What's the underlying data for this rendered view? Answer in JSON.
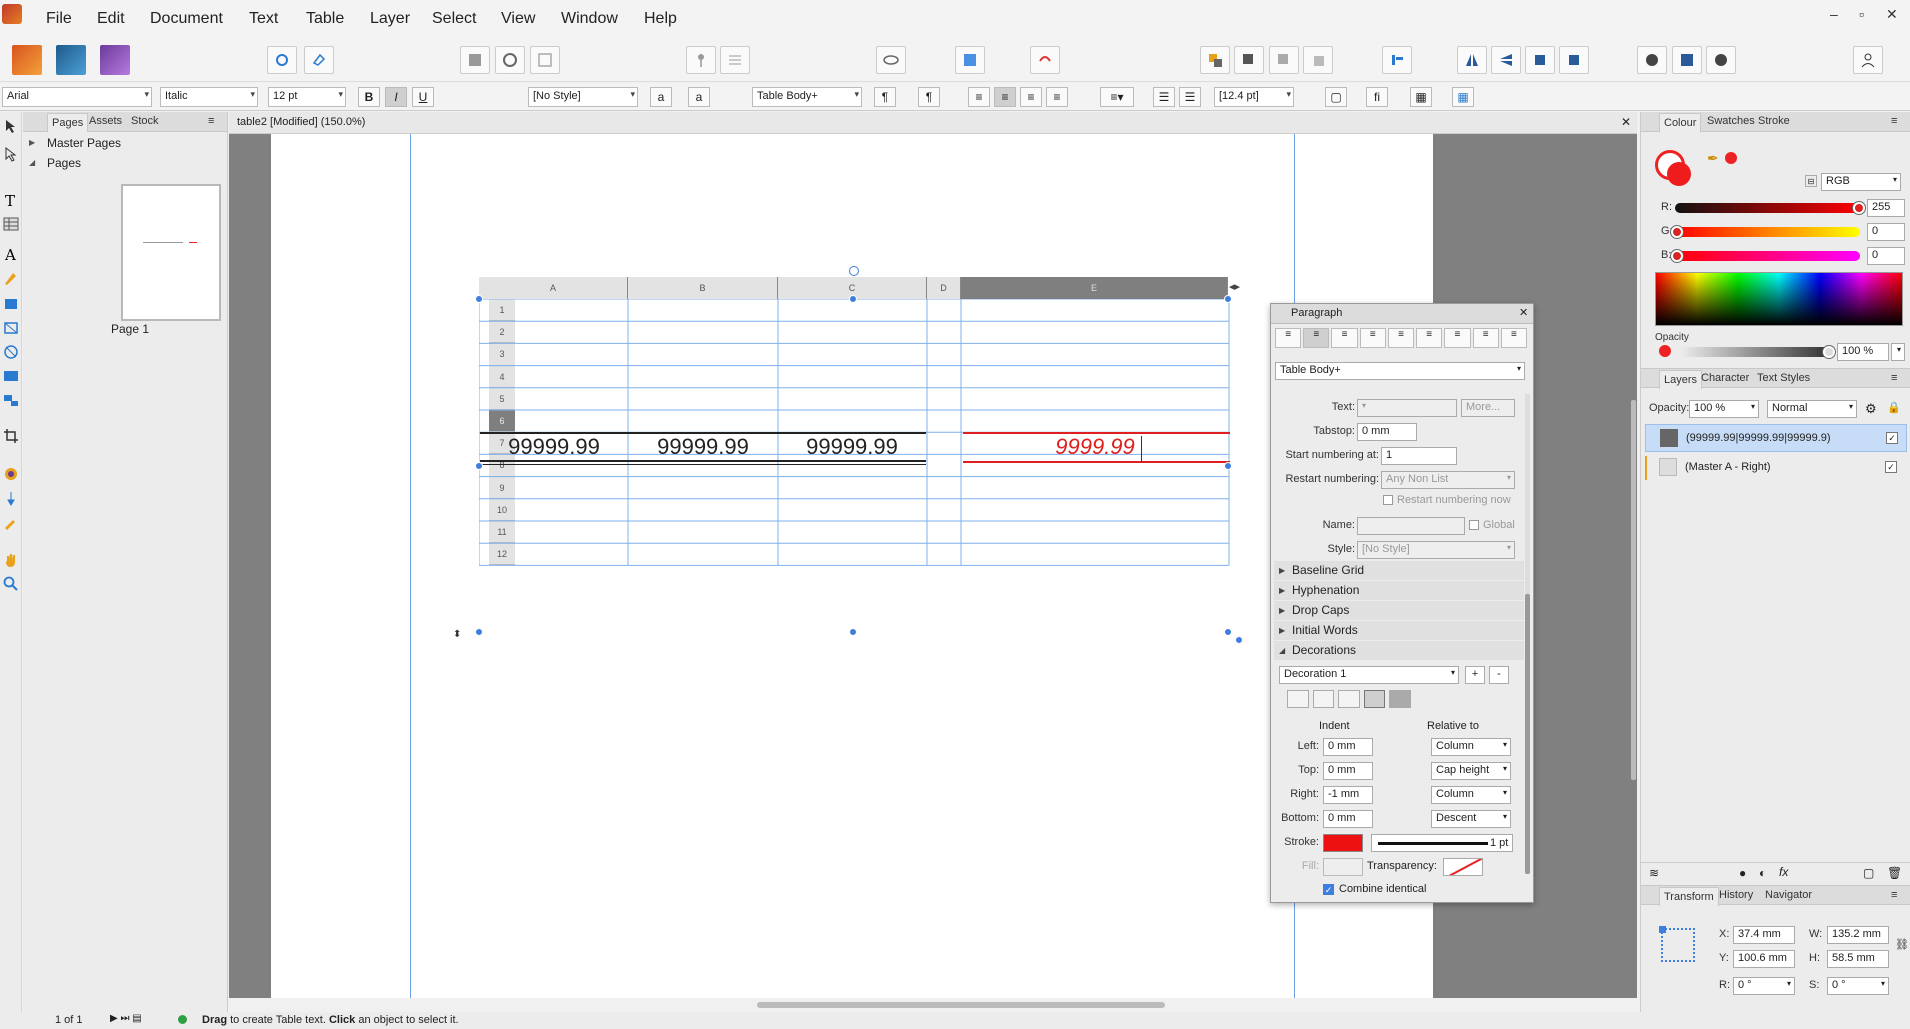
{
  "menu": {
    "items": [
      "File",
      "Edit",
      "Document",
      "Text",
      "Table",
      "Layer",
      "Select",
      "View",
      "Window",
      "Help"
    ]
  },
  "window_controls": [
    "–",
    "▫",
    "✕"
  ],
  "context_toolbar": {
    "font": "Arial",
    "style": "Italic",
    "size": "12 pt",
    "bold": "B",
    "italic": "I",
    "underline": "U",
    "text_color": "#ee1c1c",
    "char_style": "[No Style]",
    "para_style": "Table Body+",
    "leading": "[12.4 pt]"
  },
  "pages_panel": {
    "tabs": [
      "Pages",
      "Assets",
      "Stock"
    ],
    "master_pages": "Master Pages",
    "pages": "Pages",
    "page_label": "Page 1"
  },
  "document": {
    "tab_title": "table2 [Modified] (150.0%)",
    "close": "✕"
  },
  "table": {
    "columns": [
      "A",
      "B",
      "C",
      "D",
      "E"
    ],
    "rows": [
      "1",
      "2",
      "3",
      "4",
      "5",
      "6",
      "7",
      "8",
      "9",
      "10",
      "11",
      "12"
    ],
    "cells_row6": [
      "99999.99",
      "99999.99",
      "99999.99",
      "",
      "9999.99"
    ],
    "selected_row": "6",
    "accent": "#3d7ede",
    "decoration_color": "#e02020"
  },
  "paragraph_panel": {
    "title": "Paragraph",
    "style": "Table Body+",
    "text_label": "Text:",
    "more_button": "More...",
    "tabstop_label": "Tabstop:",
    "tabstop_value": "0 mm",
    "start_numbering_label": "Start numbering at:",
    "start_numbering_value": "1",
    "restart_label": "Restart numbering:",
    "restart_value": "Any Non List",
    "restart_now": "Restart numbering now",
    "name_label": "Name:",
    "global_label": "Global",
    "style_label": "Style:",
    "style_value": "[No Style]",
    "sections": [
      "Baseline Grid",
      "Hyphenation",
      "Drop Caps",
      "Initial Words",
      "Decorations"
    ],
    "decoration_select": "Decoration 1",
    "add": "+",
    "remove": "-",
    "indent_header": "Indent",
    "relative_header": "Relative to",
    "left_label": "Left:",
    "left_value": "0 mm",
    "left_rel": "Column",
    "top_label": "Top:",
    "top_value": "0 mm",
    "top_rel": "Cap height",
    "right_label": "Right:",
    "right_value": "-1 mm",
    "right_rel": "Column",
    "bottom_label": "Bottom:",
    "bottom_value": "0 mm",
    "bottom_rel": "Descent",
    "stroke_label": "Stroke:",
    "stroke_color": "#ee1111",
    "stroke_width": "1 pt",
    "fill_label": "Fill:",
    "transparency_label": "Transparency:",
    "combine_label": "Combine identical"
  },
  "colour_panel": {
    "tabs": [
      "Colour",
      "Swatches",
      "Stroke"
    ],
    "model": "RGB",
    "r_label": "R:",
    "r_value": "255",
    "g_label": "G:",
    "g_value": "0",
    "b_label": "B:",
    "b_value": "0",
    "opacity_label": "Opacity",
    "opacity_value": "100 %",
    "current_color": "#ee1c1c"
  },
  "layers_panel": {
    "tabs": [
      "Layers",
      "Character",
      "Text Styles"
    ],
    "opacity_label": "Opacity:",
    "opacity_value": "100 %",
    "blend": "Normal",
    "layers": [
      "(99999.99|99999.99|99999.9)",
      "(Master A - Right)"
    ]
  },
  "transform_panel": {
    "tabs": [
      "Transform",
      "History",
      "Navigator"
    ],
    "x_label": "X:",
    "x_value": "37.4 mm",
    "y_label": "Y:",
    "y_value": "100.6 mm",
    "w_label": "W:",
    "w_value": "135.2 mm",
    "h_label": "H:",
    "h_value": "58.5 mm",
    "r_label": "R:",
    "r_value": "0 °",
    "s_label": "S:",
    "s_value": "0 °"
  },
  "status": {
    "page_count": "1 of 1",
    "hint_bold1": "Drag",
    "hint1": " to create Table text. ",
    "hint_bold2": "Click",
    "hint2": " an object to select it."
  }
}
